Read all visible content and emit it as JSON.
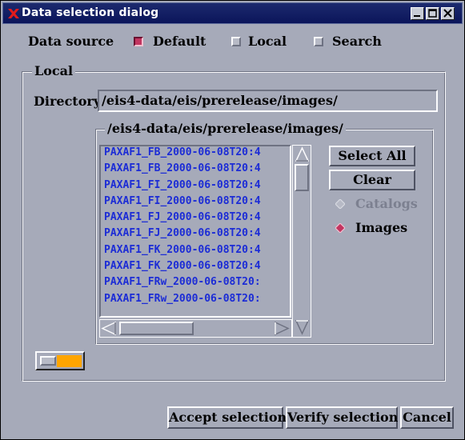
{
  "window": {
    "title": "Data selection dialog"
  },
  "data_source": {
    "label": "Data source",
    "options": [
      {
        "label": "Default",
        "checked": true
      },
      {
        "label": "Local",
        "checked": false
      },
      {
        "label": "Search",
        "checked": false
      }
    ]
  },
  "local": {
    "legend": "Local",
    "directory_label": "Directory",
    "directory_value": "/eis4-data/eis/prerelease/images/",
    "folder_legend": "/eis4-data/eis/prerelease/images/",
    "files": [
      "PAXAF1_FB_2000-06-08T20:4",
      "PAXAF1_FB_2000-06-08T20:4",
      "PAXAF1_FI_2000-06-08T20:4",
      "PAXAF1_FI_2000-06-08T20:4",
      "PAXAF1_FJ_2000-06-08T20:4",
      "PAXAF1_FJ_2000-06-08T20:4",
      "PAXAF1_FK_2000-06-08T20:4",
      "PAXAF1_FK_2000-06-08T20:4",
      "PAXAF1_FRw_2000-06-08T20:",
      "PAXAF1_FRw_2000-06-08T20:"
    ],
    "select_all_label": "Select All",
    "clear_label": "Clear",
    "catalogs_label": "Catalogs",
    "images_label": "Images",
    "selected_type": "Images"
  },
  "footer": {
    "accept_label": "Accept selection",
    "verify_label": "Verify selection",
    "cancel_label": "Cancel"
  },
  "colors": {
    "background": "#a6aab9",
    "titlebar": "#0b155a",
    "checked": "#c23560",
    "list_text": "#1c2cd6",
    "indicator": "#ffa500"
  },
  "icons": {
    "app": "x-logo-icon",
    "minimize": "minimize-icon",
    "maximize": "maximize-icon",
    "close": "close-icon"
  }
}
